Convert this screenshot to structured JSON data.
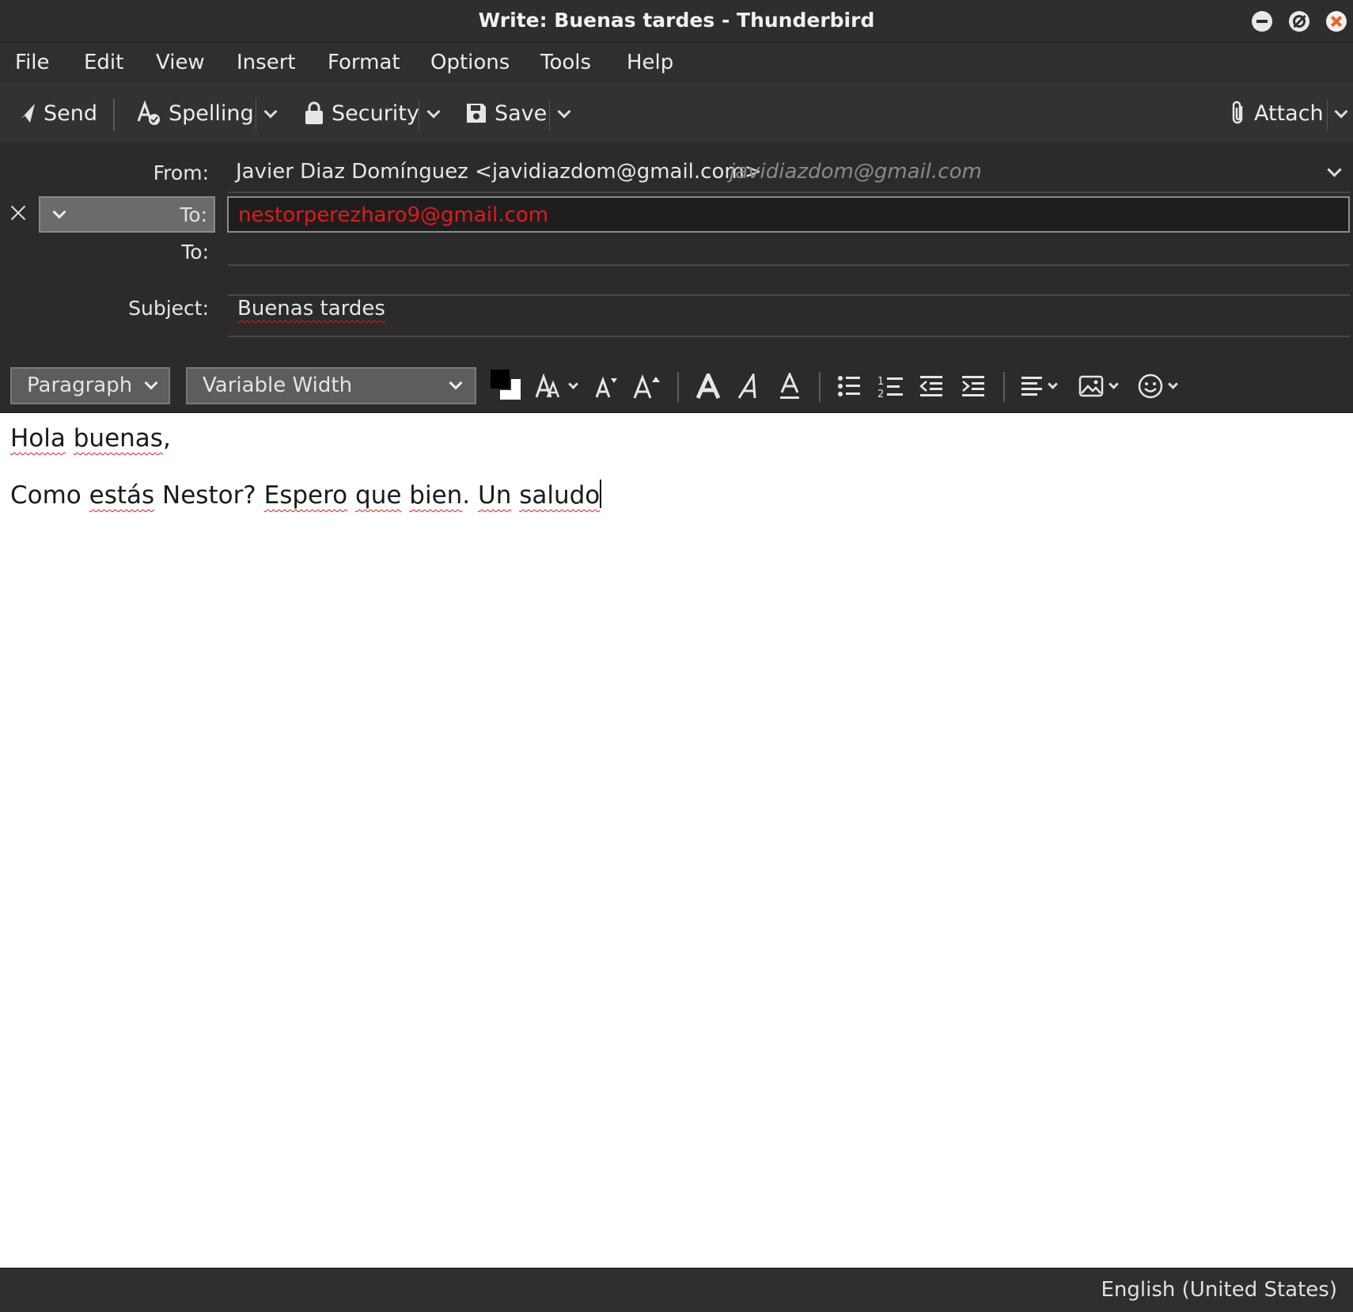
{
  "window": {
    "title": "Write: Buenas tardes - Thunderbird"
  },
  "menubar": {
    "items": [
      "File",
      "Edit",
      "View",
      "Insert",
      "Format",
      "Options",
      "Tools",
      "Help"
    ]
  },
  "toolbar": {
    "send_label": "Send",
    "spelling_label": "Spelling",
    "security_label": "Security",
    "save_label": "Save",
    "attach_label": "Attach"
  },
  "headers": {
    "from_label": "From:",
    "from_value": "Javier Diaz Domínguez <javidiazdom@gmail.com>",
    "from_identity_hint": "javidiazdom@gmail.com",
    "to_type": "To:",
    "to_value": "nestorperezharo9@gmail.com",
    "to_label_2": "To:",
    "subject_label": "Subject:",
    "subject_value": "Buenas tardes"
  },
  "format_toolbar": {
    "paragraph_select": "Paragraph",
    "font_select": "Variable Width"
  },
  "body": {
    "line1_words": [
      "Hola",
      "buenas",
      ","
    ],
    "line2": {
      "w1": "Como",
      "w2": "estás",
      "w3": "Nestor?",
      "w4": "Espero",
      "w5": "que",
      "w6": "bien",
      "w7": ".",
      "w8": "Un",
      "w9": "saludo"
    }
  },
  "statusbar": {
    "language": "English (United States)"
  },
  "colors": {
    "invalid_address": "#e01b1b",
    "window_close": "#e8652b"
  }
}
